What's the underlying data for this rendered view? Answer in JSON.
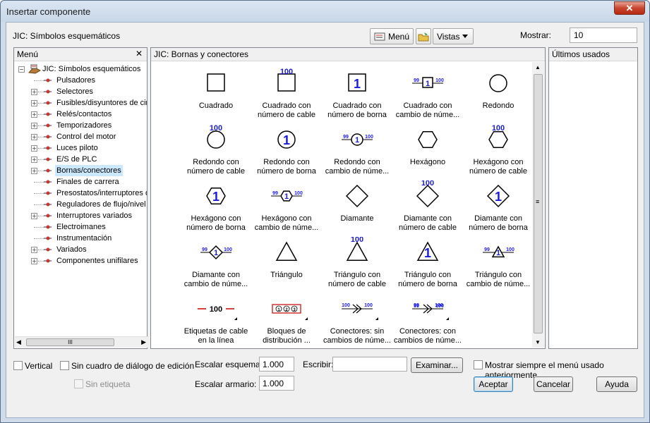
{
  "window": {
    "title": "Insertar componente",
    "close_symbol": "✕"
  },
  "toolbar": {
    "library_label": "JIC: Símbolos esquemáticos",
    "menu_button": "Menú",
    "vistas_button": "Vistas",
    "mostrar_label": "Mostrar:",
    "mostrar_value": "10"
  },
  "menu_panel": {
    "header": "Menú",
    "close_symbol": "✕",
    "root": "JIC: Símbolos esquemáticos",
    "items": [
      {
        "label": "Pulsadores",
        "expandable": false
      },
      {
        "label": "Selectores",
        "expandable": true
      },
      {
        "label": "Fusibles/disyuntores de cir",
        "expandable": true
      },
      {
        "label": "Relés/contactos",
        "expandable": true
      },
      {
        "label": "Temporizadores",
        "expandable": true
      },
      {
        "label": "Control del motor",
        "expandable": true
      },
      {
        "label": "Luces piloto",
        "expandable": true
      },
      {
        "label": "E/S de PLC",
        "expandable": true
      },
      {
        "label": "Bornas/conectores",
        "expandable": true,
        "selected": true
      },
      {
        "label": "Finales de carrera",
        "expandable": false
      },
      {
        "label": "Presostatos/interruptores d",
        "expandable": false
      },
      {
        "label": "Reguladores de flujo/nivel",
        "expandable": false
      },
      {
        "label": "Interruptores variados",
        "expandable": true
      },
      {
        "label": "Electroimanes",
        "expandable": false
      },
      {
        "label": "Instrumentación",
        "expandable": false
      },
      {
        "label": "Variados",
        "expandable": true
      },
      {
        "label": "Componentes unifilares",
        "expandable": true
      }
    ],
    "hscroll_thumb": "III"
  },
  "symbols_panel": {
    "header": "JIC: Bornas y conectores",
    "scroll_grip": "≡",
    "symbols": [
      {
        "label1": "Cuadrado",
        "label2": "",
        "shape": "square",
        "number": "",
        "cable": ""
      },
      {
        "label1": "Cuadrado con",
        "label2": "número de cable",
        "shape": "square",
        "number": "",
        "cable": "100"
      },
      {
        "label1": "Cuadrado con",
        "label2": "número de borna",
        "shape": "square",
        "number": "1",
        "cable": ""
      },
      {
        "label1": "Cuadrado con",
        "label2": "cambio de núme...",
        "shape": "square-change",
        "number": "1",
        "cable": ""
      },
      {
        "label1": "Redondo",
        "label2": "",
        "shape": "circle",
        "number": "",
        "cable": ""
      },
      {
        "label1": "Redondo con",
        "label2": "número de cable",
        "shape": "circle",
        "number": "",
        "cable": "100"
      },
      {
        "label1": "Redondo con",
        "label2": "número de borna",
        "shape": "circle",
        "number": "1",
        "cable": ""
      },
      {
        "label1": "Redondo con",
        "label2": "cambio de núme...",
        "shape": "circle-change",
        "number": "1",
        "cable": ""
      },
      {
        "label1": "Hexágono",
        "label2": "",
        "shape": "hexagon",
        "number": "",
        "cable": ""
      },
      {
        "label1": "Hexágono con",
        "label2": "número de cable",
        "shape": "hexagon",
        "number": "",
        "cable": "100"
      },
      {
        "label1": "Hexágono con",
        "label2": "número de borna",
        "shape": "hexagon",
        "number": "1",
        "cable": ""
      },
      {
        "label1": "Hexágono con",
        "label2": "cambio de núme...",
        "shape": "hexagon-change",
        "number": "1",
        "cable": ""
      },
      {
        "label1": "Diamante",
        "label2": "",
        "shape": "diamond",
        "number": "",
        "cable": ""
      },
      {
        "label1": "Diamante con",
        "label2": "número de cable",
        "shape": "diamond",
        "number": "",
        "cable": "100"
      },
      {
        "label1": "Diamante con",
        "label2": "número de borna",
        "shape": "diamond",
        "number": "1",
        "cable": ""
      },
      {
        "label1": "Diamante con",
        "label2": "cambio de núme...",
        "shape": "diamond-change",
        "number": "1",
        "cable": ""
      },
      {
        "label1": "Triángulo",
        "label2": "",
        "shape": "triangle",
        "number": "",
        "cable": ""
      },
      {
        "label1": "Triángulo con",
        "label2": "número de cable",
        "shape": "triangle",
        "number": "",
        "cable": "100"
      },
      {
        "label1": "Triángulo con",
        "label2": "número de borna",
        "shape": "triangle",
        "number": "1",
        "cable": ""
      },
      {
        "label1": "Triángulo con",
        "label2": "cambio de núme...",
        "shape": "triangle-change",
        "number": "1",
        "cable": ""
      },
      {
        "label1": "Etiquetas de cable",
        "label2": "en la línea",
        "shape": "wire-label",
        "number": "",
        "cable": "100"
      },
      {
        "label1": "Bloques de",
        "label2": "distribución ...",
        "shape": "dist-block",
        "number": "",
        "cable": ""
      },
      {
        "label1": "Conectores: sin",
        "label2": "cambios de núme...",
        "shape": "connector",
        "number": "",
        "cable": "100"
      },
      {
        "label1": "Conectores: con",
        "label2": "cambios de núme...",
        "shape": "connector-change",
        "number": "",
        "cable": "100"
      }
    ],
    "change_left": "99",
    "change_right": "100",
    "block_digits": [
      "1",
      "2",
      "3"
    ]
  },
  "recent_panel": {
    "header": "Últimos usados"
  },
  "bottom": {
    "vertical": "Vertical",
    "sin_cuadro": "Sin cuadro de diálogo de edición",
    "sin_etiqueta": "Sin etiqueta",
    "escalar_esquema_label": "Escalar esquema:",
    "escalar_esquema_value": "1.000",
    "escalar_armario_label": "Escalar armario:",
    "escalar_armario_value": "1.000",
    "escribir_label": "Escribir:",
    "escribir_value": "",
    "examinar": "Examinar...",
    "mostrar_siempre": "Mostrar siempre el menú usado anteriormente",
    "aceptar": "Aceptar",
    "cancelar": "Cancelar",
    "ayuda": "Ayuda"
  },
  "colors": {
    "symbol_blue": "#1a1adc",
    "accent_red": "#cc0000",
    "selection": "#cce8ff"
  }
}
